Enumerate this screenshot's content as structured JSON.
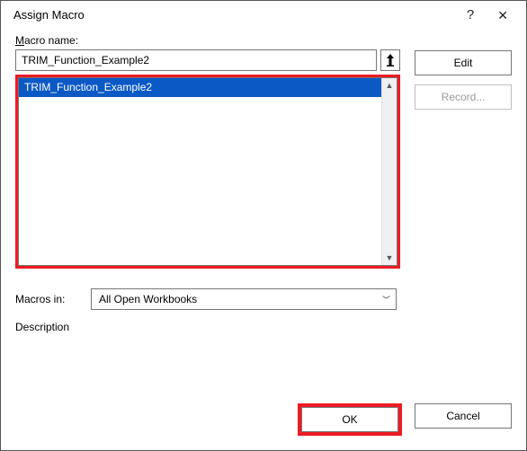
{
  "dialog": {
    "title": "Assign Macro",
    "help_glyph": "?",
    "close_glyph": "✕"
  },
  "macro_name_label_pre": "M",
  "macro_name_label_post": "acro name:",
  "macro_name_value": "TRIM_Function_Example2",
  "macro_list": {
    "items": [
      "TRIM_Function_Example2"
    ]
  },
  "buttons": {
    "edit": "Edit",
    "record": "Record...",
    "ok": "OK",
    "cancel": "Cancel"
  },
  "macros_in_label": "Macros in:",
  "macros_in_value": "All Open Workbooks",
  "description_label": "Description"
}
